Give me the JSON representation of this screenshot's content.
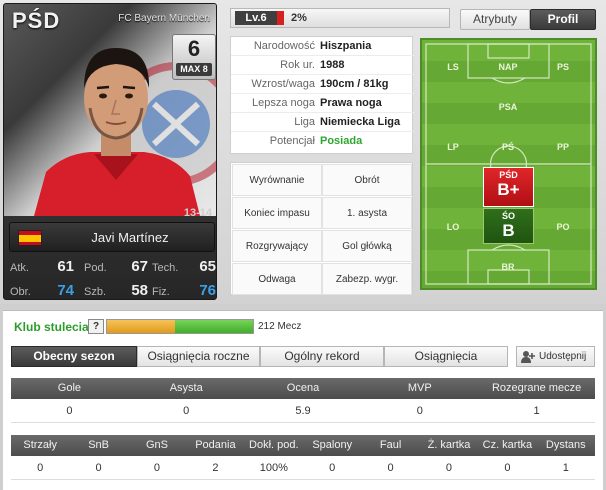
{
  "card": {
    "position": "PŚD",
    "club": "FC Bayern München",
    "overall": "6",
    "max_label": "MAX 8",
    "season": "13-14",
    "player_name": "Javi Martínez",
    "flag_icon": "spain-flag-icon",
    "stats": [
      {
        "label": "Atk.",
        "value": "61",
        "highlight": false
      },
      {
        "label": "Pod.",
        "value": "67",
        "highlight": false
      },
      {
        "label": "Tech.",
        "value": "65",
        "highlight": false
      },
      {
        "label": "Obr.",
        "value": "74",
        "highlight": true
      },
      {
        "label": "Szb.",
        "value": "58",
        "highlight": false
      },
      {
        "label": "Fiz.",
        "value": "76",
        "highlight": true
      }
    ]
  },
  "level": {
    "label": "Lv.6",
    "percent": "2%",
    "progress_fraction": 0.02
  },
  "tabs": {
    "attributes": "Atrybuty",
    "profile": "Profil",
    "active": "profile"
  },
  "info": [
    {
      "key": "Narodowość",
      "value": "Hiszpania",
      "green": false
    },
    {
      "key": "Rok ur.",
      "value": "1988",
      "green": false
    },
    {
      "key": "Wzrost/waga",
      "value": "190cm / 81kg",
      "green": false
    },
    {
      "key": "Lepsza noga",
      "value": "Prawa noga",
      "green": false
    },
    {
      "key": "Liga",
      "value": "Niemiecka Liga",
      "green": false
    },
    {
      "key": "Potencjał",
      "value": "Posiada",
      "green": true
    }
  ],
  "skills": [
    "Wyrównanie",
    "Obrót",
    "Koniec impasu",
    "1. asysta",
    "Rozgrywający",
    "Gol główką",
    "Odwaga",
    "Zabezp. wygr."
  ],
  "pitch": {
    "labels": [
      "LS",
      "NAP",
      "PS",
      "PSA",
      "LP",
      "PŚ",
      "PP",
      "LO",
      "ŚO",
      "PO",
      "BR"
    ],
    "main_position": {
      "name": "PŚD",
      "grade": "B+"
    },
    "alt_position": {
      "name": "ŚO",
      "grade": "B"
    }
  },
  "club_century": {
    "title": "Klub stulecia",
    "help": "?",
    "matches_label": "212 Mecz",
    "colors": {
      "first": "#e29a1a",
      "second": "#3fae2a"
    }
  },
  "section_tabs": [
    "Obecny sezon",
    "Osiągnięcia roczne",
    "Ogólny rekord",
    "Osiągnięcia"
  ],
  "share_label": "Udostępnij",
  "table1": {
    "headers": [
      "Gole",
      "Asysta",
      "Ocena",
      "MVP",
      "Rozegrane mecze"
    ],
    "values": [
      "0",
      "0",
      "5.9",
      "0",
      "1"
    ]
  },
  "table2": {
    "headers": [
      "Strzały",
      "SnB",
      "GnS",
      "Podania",
      "Dokł. pod.",
      "Spalony",
      "Faul",
      "Ż. kartka",
      "Cz. kartka",
      "Dystans"
    ],
    "values": [
      "0",
      "0",
      "0",
      "2",
      "100%",
      "0",
      "0",
      "0",
      "0",
      "1"
    ]
  }
}
